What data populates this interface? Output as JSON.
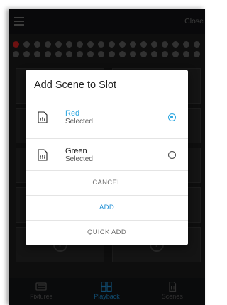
{
  "header": {
    "close_label": "Close"
  },
  "dialog": {
    "title": "Add Scene to Slot",
    "options": [
      {
        "name": "Red",
        "status": "Selected",
        "checked": true,
        "color": "#2aa6e0"
      },
      {
        "name": "Green",
        "status": "Selected",
        "checked": false,
        "color": "#111111"
      }
    ],
    "actions": {
      "cancel": "CANCEL",
      "add": "ADD",
      "quick_add": "QUICK ADD"
    }
  },
  "tabs": [
    {
      "label": "Fixtures",
      "icon": "keyboard-icon",
      "active": false
    },
    {
      "label": "Playback",
      "icon": "grid-icon",
      "active": true
    },
    {
      "label": "Scenes",
      "icon": "sliders-file-icon",
      "active": false
    }
  ],
  "colors": {
    "accent": "#1f8fd6",
    "background": "#1b1b1b",
    "dialog": "#ffffff",
    "active_dot": "#c71f1f"
  }
}
